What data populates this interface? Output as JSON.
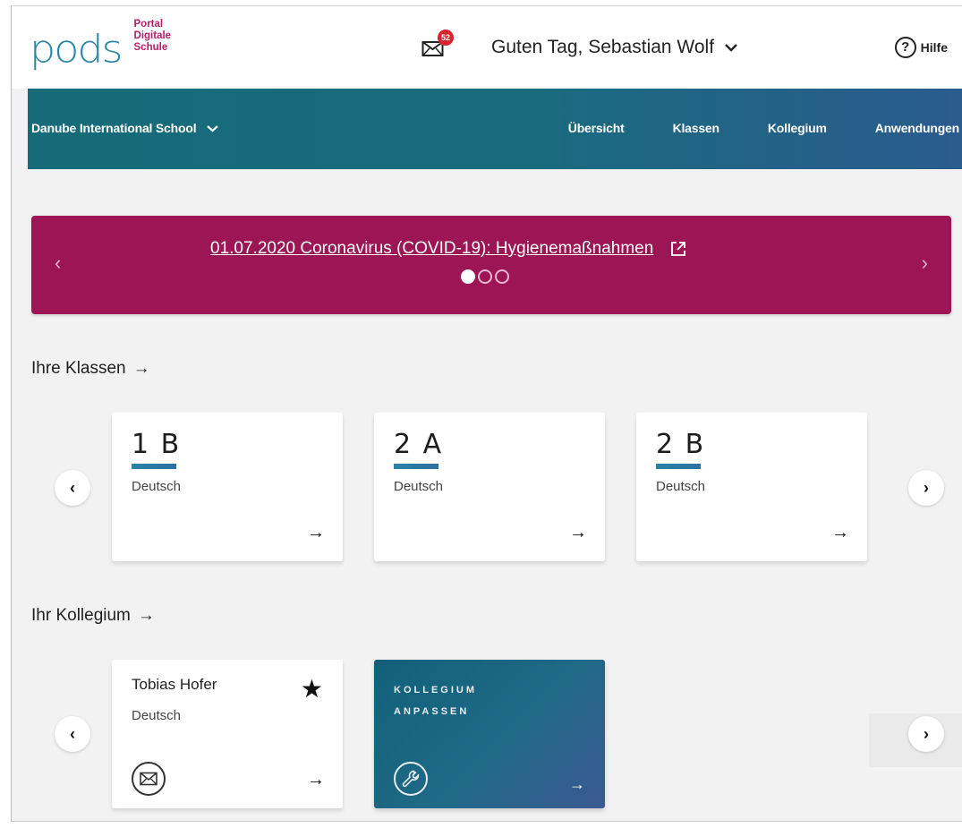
{
  "header": {
    "logo_word": "pods",
    "logo_sub": [
      "Portal",
      "Digitale",
      "Schule"
    ],
    "mail_badge": "52",
    "greeting": "Guten Tag, Sebastian Wolf",
    "help_label": "Hilfe",
    "help_icon": "?"
  },
  "nav": {
    "school": "Danube International School",
    "links": [
      "Übersicht",
      "Klassen",
      "Kollegium",
      "Anwendungen"
    ]
  },
  "banner": {
    "text": "01.07.2020 Coronavirus (COVID-19): Hygienemaßnahmen",
    "prev": "‹",
    "next": "›",
    "dots_total": 3,
    "dots_active": 1
  },
  "classes": {
    "title": "Ihre Klassen",
    "arrow": "→",
    "prev": "‹",
    "next": "›",
    "items": [
      {
        "name": "1 B",
        "subject": "Deutsch"
      },
      {
        "name": "2 A",
        "subject": "Deutsch"
      },
      {
        "name": "2 B",
        "subject": "Deutsch"
      }
    ]
  },
  "kollegium": {
    "title": "Ihr Kollegium",
    "arrow": "→",
    "prev": "‹",
    "next": "›",
    "person": {
      "name": "Tobias Hofer",
      "subject": "Deutsch",
      "star": "★"
    },
    "customize": {
      "line1": "KOLLEGIUM",
      "line2": "ANPASSEN"
    }
  },
  "colors": {
    "brand_teal": "#2e86a6",
    "brand_magenta": "#b81d6a",
    "banner": "#9c1555",
    "nav_start": "#156b78",
    "nav_end": "#2a5c8e",
    "badge_red": "#d9242f"
  }
}
